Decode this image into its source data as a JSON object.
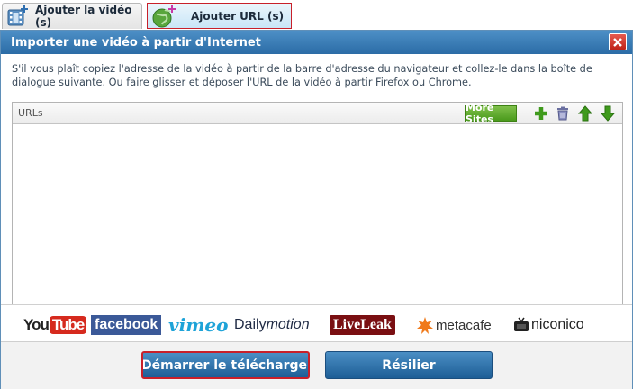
{
  "tabs": [
    {
      "label": "Ajouter la vidéo (s)",
      "icon": "film-add-icon"
    },
    {
      "label": "Ajouter URL (s)",
      "icon": "globe-add-icon"
    }
  ],
  "dialog": {
    "title": "Importer une vidéo à partir d'Internet",
    "instructions": "S'il vous plaît copiez l'adresse de la vidéo à partir de la barre d'adresse du navigateur et collez-le dans la boîte de dialogue suivante. Ou faire glisser et déposer l'URL de la vidéo à partir Firefox ou Chrome.",
    "url_header": "URLs",
    "more_sites": "More Sites",
    "url_value": ""
  },
  "logos": [
    {
      "name": "youtube",
      "text_a": "You",
      "text_b": "Tube"
    },
    {
      "name": "facebook",
      "text": "facebook"
    },
    {
      "name": "vimeo",
      "text": "vimeo"
    },
    {
      "name": "dailymotion",
      "text_a": "Daily",
      "text_b": "motion"
    },
    {
      "name": "liveleak",
      "text": "LiveLeak"
    },
    {
      "name": "metacafe",
      "text": "metacafe"
    },
    {
      "name": "niconico",
      "text": "niconico"
    }
  ],
  "buttons": {
    "start": "Démarrer le téléchargement",
    "cancel": "Résilier"
  },
  "colors": {
    "accent_red": "#c8202a",
    "title_blue": "#2b6ca6",
    "green": "#4a9a1c"
  }
}
